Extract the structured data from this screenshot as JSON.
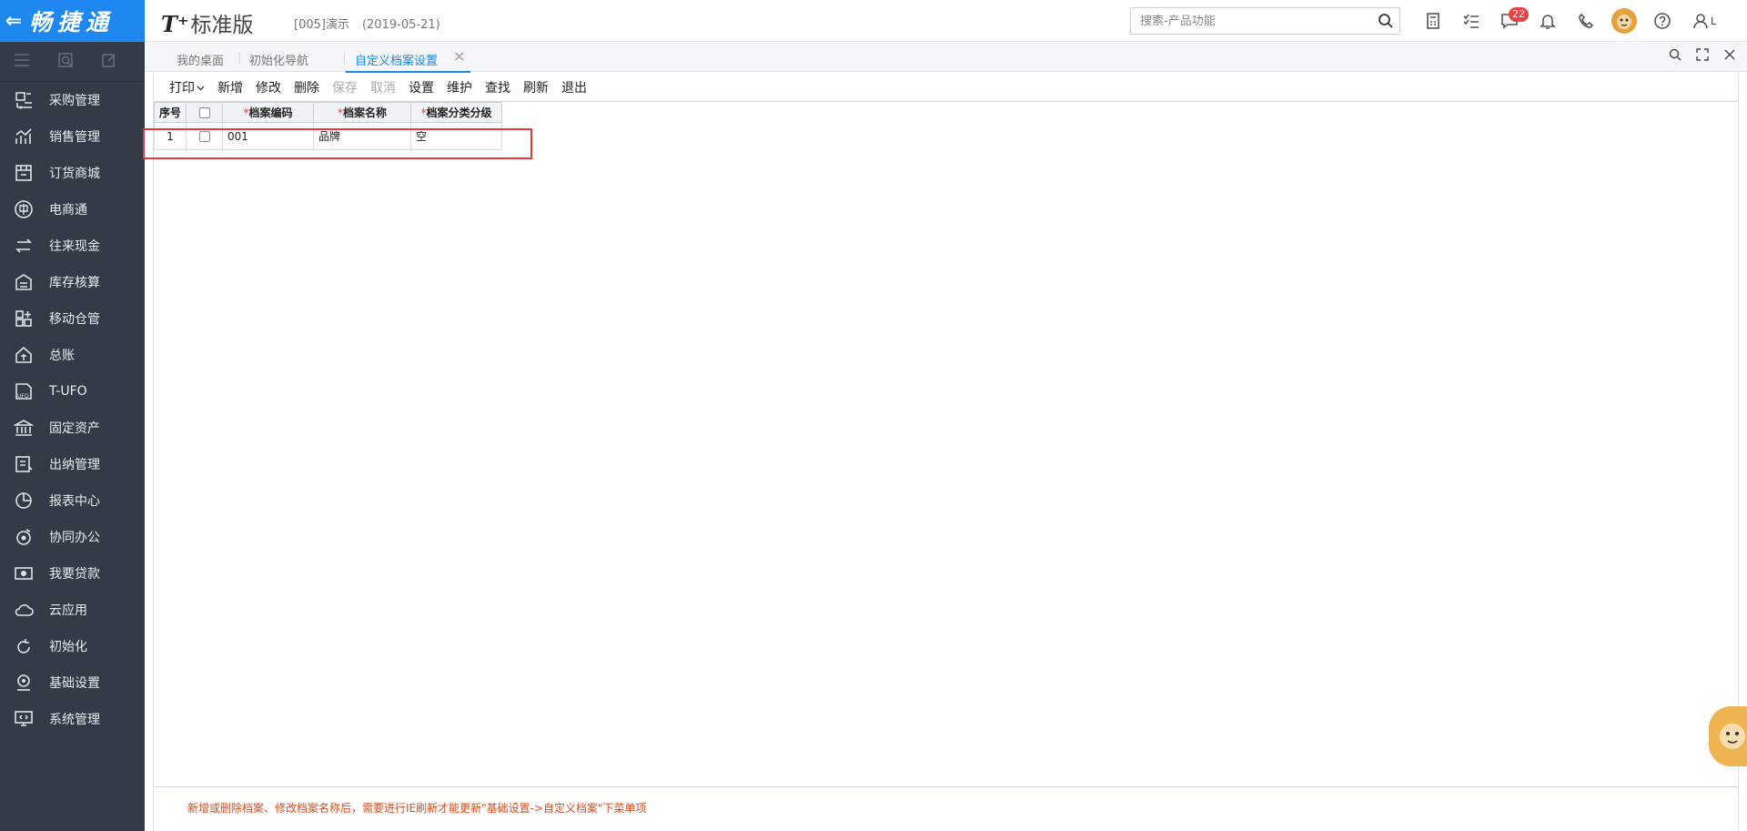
{
  "brand": {
    "back_glyph": "⇐",
    "name": "畅捷通"
  },
  "sidebar": {
    "tools": [
      "menu-icon",
      "search-panel-icon",
      "edit-panel-icon"
    ],
    "items": [
      {
        "label": "采购管理",
        "icon": "purchase-icon"
      },
      {
        "label": "销售管理",
        "icon": "sales-icon"
      },
      {
        "label": "订货商城",
        "icon": "mall-icon"
      },
      {
        "label": "电商通",
        "icon": "ecommerce-icon"
      },
      {
        "label": "往来现金",
        "icon": "cash-flow-icon"
      },
      {
        "label": "库存核算",
        "icon": "inventory-icon"
      },
      {
        "label": "移动仓管",
        "icon": "mobile-warehouse-icon"
      },
      {
        "label": "总账",
        "icon": "ledger-icon"
      },
      {
        "label": "T-UFO",
        "icon": "ufo-icon"
      },
      {
        "label": "固定资产",
        "icon": "asset-icon"
      },
      {
        "label": "出纳管理",
        "icon": "cashier-icon"
      },
      {
        "label": "报表中心",
        "icon": "report-icon"
      },
      {
        "label": "协同办公",
        "icon": "collab-icon"
      },
      {
        "label": "我要贷款",
        "icon": "loan-icon"
      },
      {
        "label": "云应用",
        "icon": "cloud-icon"
      },
      {
        "label": "初始化",
        "icon": "init-icon"
      },
      {
        "label": "基础设置",
        "icon": "settings-icon"
      },
      {
        "label": "系统管理",
        "icon": "system-icon"
      }
    ]
  },
  "header": {
    "logo_t": "T⁺",
    "logo_text": "标准版",
    "account": "[005]演示",
    "date": "(2019-05-21)",
    "search_placeholder": "搜索-产品功能",
    "message_count": "22",
    "user_initial": "L"
  },
  "tabs": [
    {
      "label": "我的桌面"
    },
    {
      "label": "初始化导航"
    },
    {
      "label": "自定义档案设置"
    }
  ],
  "tab_close_glyph": "×",
  "toolbar": {
    "print": "打印",
    "new": "新增",
    "edit": "修改",
    "delete": "删除",
    "save": "保存",
    "cancel": "取消",
    "settings": "设置",
    "maintain": "维护",
    "find": "查找",
    "refresh": "刷新",
    "exit": "退出"
  },
  "table": {
    "headers": {
      "seq": "序号",
      "code": "档案编码",
      "name": "档案名称",
      "level": "档案分类分级"
    },
    "required_mark": "*",
    "rows": [
      {
        "seq": "1",
        "code": "001",
        "name": "品牌",
        "level": "空"
      }
    ]
  },
  "note": "新增或删除档案、修改档案名称后，需要进行IE刷新才能更新\"基础设置->自定义档案\"下菜单项",
  "colors": {
    "accent": "#1e87f0",
    "sidebar": "#333b47",
    "highlight": "#e33b3b",
    "note": "#d24f24"
  }
}
